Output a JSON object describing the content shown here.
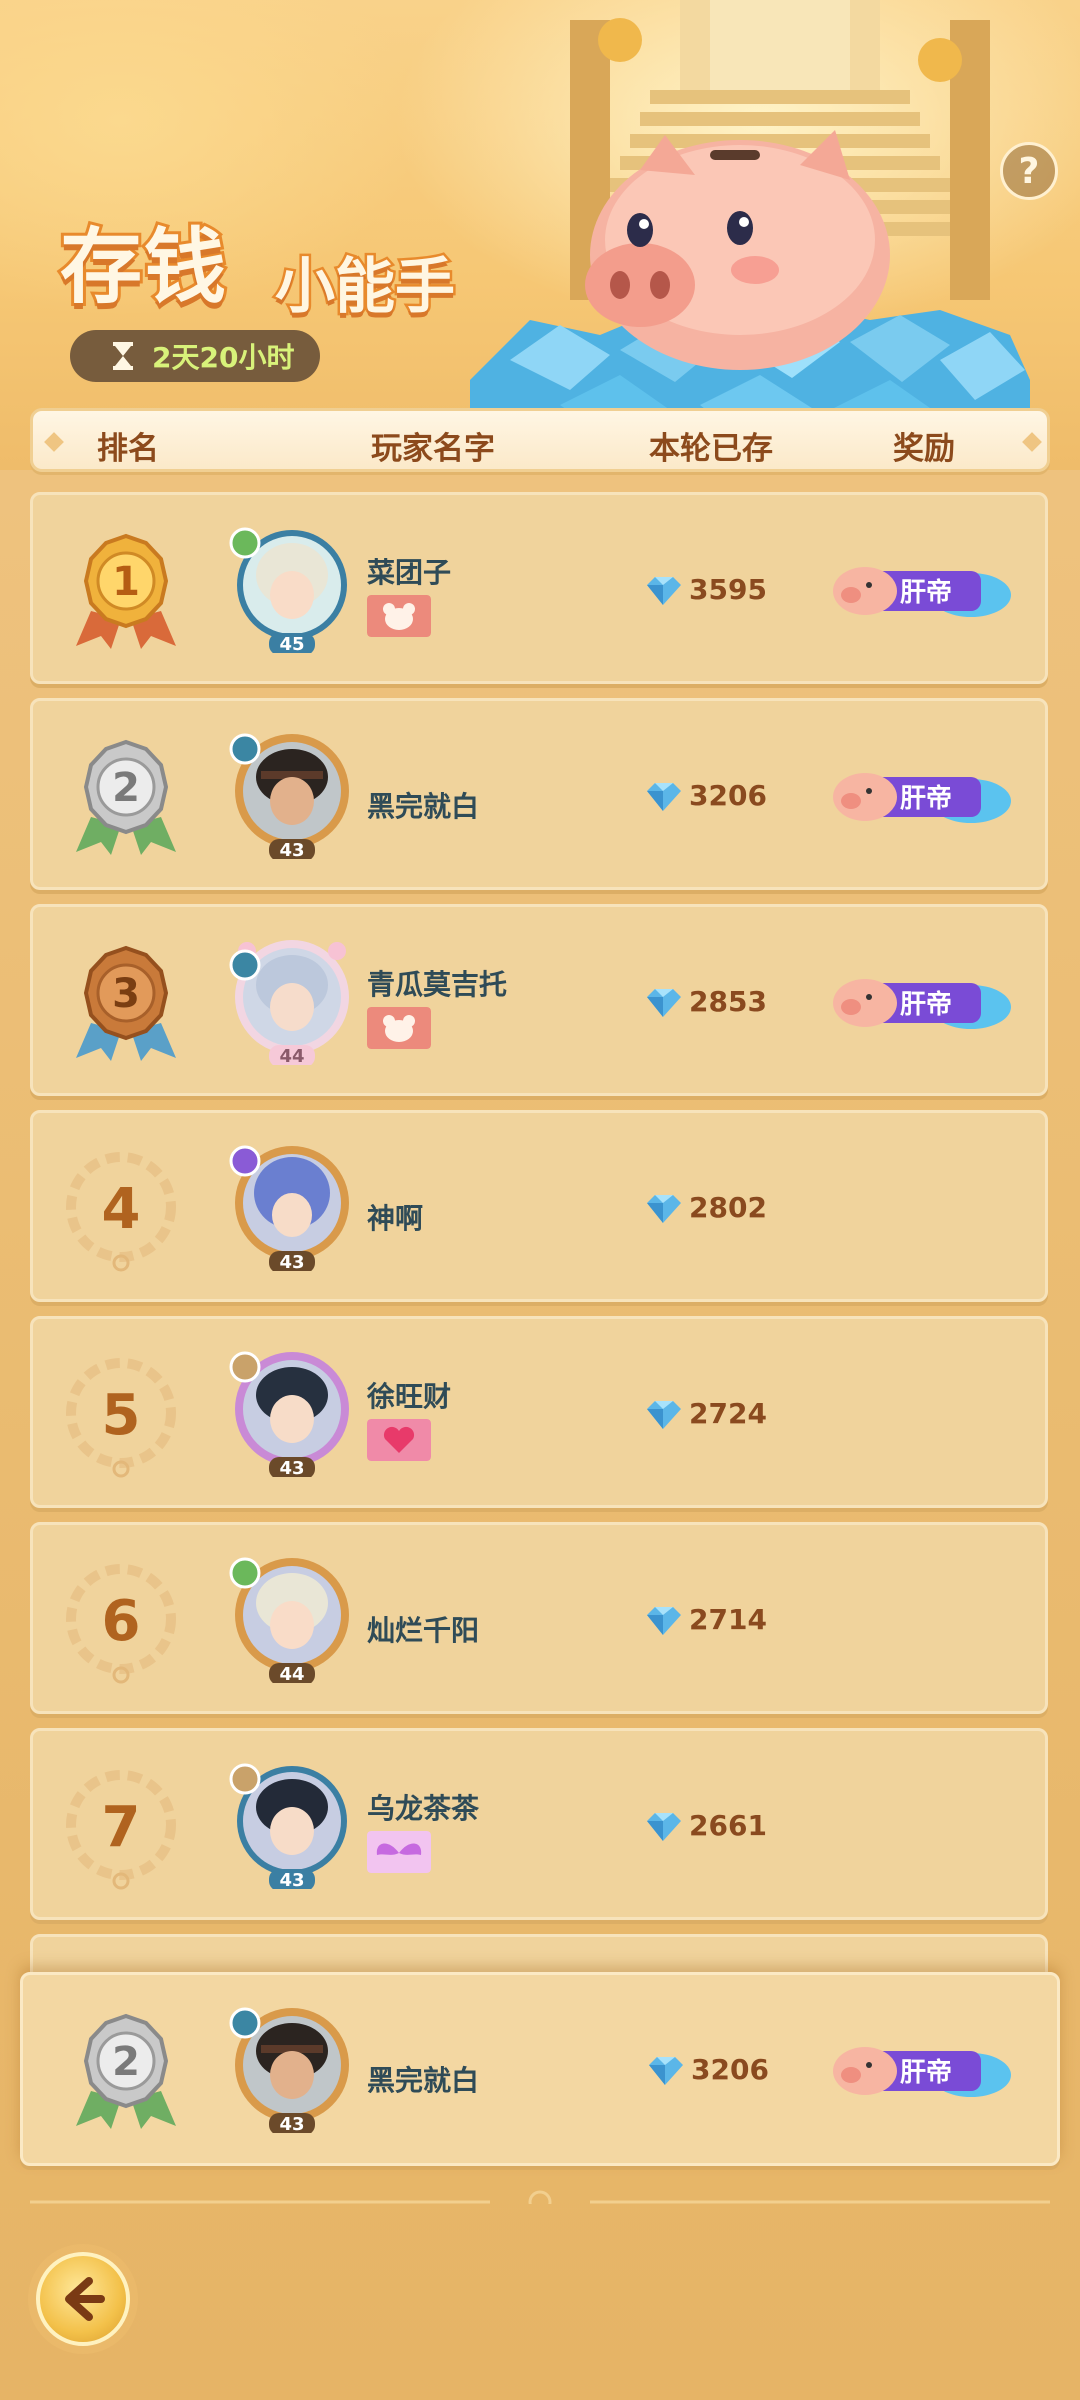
{
  "header": {
    "title_big": "存钱",
    "title_small": "小能手",
    "timer": "2天20小时",
    "help": "?"
  },
  "columns": {
    "rank": "排名",
    "name": "玩家名字",
    "saved": "本轮已存",
    "reward": "奖励"
  },
  "rows": [
    {
      "rank": "1",
      "level": "45",
      "name": "菜团子",
      "saved": "3595",
      "reward_label": "肝帝"
    },
    {
      "rank": "2",
      "level": "43",
      "name": "黑完就白",
      "saved": "3206",
      "reward_label": "肝帝"
    },
    {
      "rank": "3",
      "level": "44",
      "name": "青瓜莫吉托",
      "saved": "2853",
      "reward_label": "肝帝"
    },
    {
      "rank": "4",
      "level": "43",
      "name": "神啊",
      "saved": "2802"
    },
    {
      "rank": "5",
      "level": "43",
      "name": "徐旺财",
      "saved": "2724"
    },
    {
      "rank": "6",
      "level": "44",
      "name": "灿烂千阳",
      "saved": "2714"
    },
    {
      "rank": "7",
      "level": "43",
      "name": "乌龙茶茶",
      "saved": "2661"
    }
  ],
  "self_row": {
    "rank": "2",
    "level": "43",
    "name": "黑完就白",
    "saved": "3206",
    "reward_label": "肝帝"
  },
  "colors": {
    "gold": "#e9a93a",
    "silver": "#c9c9c9",
    "bronze": "#c97a3a",
    "gem": "#5bb6e8",
    "reward_purple": "#7a4bd6"
  }
}
